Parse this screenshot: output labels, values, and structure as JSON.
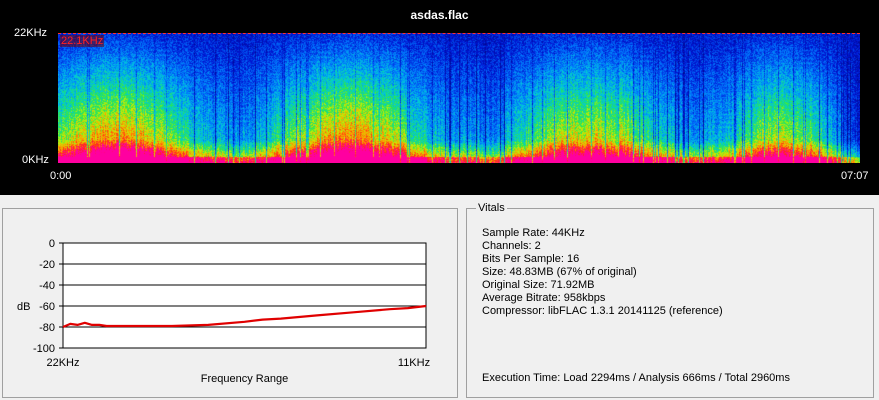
{
  "window": {
    "title": "asdas.flac"
  },
  "spectrogram": {
    "y_top_label": "22KHz",
    "y_bottom_label": "0KHz",
    "x_start_label": "0:00",
    "x_end_label": "07:07",
    "cutoff_label": "22.1KHz",
    "cutoff_color": "#ff2020"
  },
  "graph": {
    "y_label": "dB",
    "x_label": "Frequency Range",
    "x_start_label": "22KHz",
    "x_end_label": "11KHz",
    "line_color": "#e00000"
  },
  "chart_data": {
    "type": "line",
    "title": "",
    "xlabel": "Frequency Range",
    "ylabel": "dB",
    "y_ticks": [
      "0",
      "-20",
      "-40",
      "-60",
      "-80",
      "-100"
    ],
    "ylim": [
      -100,
      0
    ],
    "x_tick_labels": [
      "22KHz",
      "11KHz"
    ],
    "grid": true,
    "series": [
      {
        "x": [
          0,
          0.02,
          0.04,
          0.06,
          0.08,
          0.1,
          0.12,
          0.15,
          0.2,
          0.3,
          0.4,
          0.5,
          0.55,
          0.6,
          0.7,
          0.8,
          0.9,
          0.95,
          1.0
        ],
        "values": [
          -80,
          -77,
          -78,
          -76,
          -78,
          -78,
          -79,
          -79,
          -79,
          -79,
          -78,
          -75,
          -73,
          -72,
          -69,
          -66,
          -63,
          -62,
          -60
        ]
      }
    ]
  },
  "vitals": {
    "legend": "Vitals",
    "sample_rate": "Sample Rate: 44KHz",
    "channels": "Channels: 2",
    "bits_per_sample": "Bits Per Sample: 16",
    "size": "Size: 48.83MB (67% of original)",
    "original_size": "Original Size: 71.92MB",
    "average_bitrate": "Average Bitrate: 958kbps",
    "compressor": "Compressor: libFLAC 1.3.1 20141125 (reference)",
    "execution_time": "Execution Time: Load 2294ms / Analysis 666ms / Total 2960ms"
  }
}
